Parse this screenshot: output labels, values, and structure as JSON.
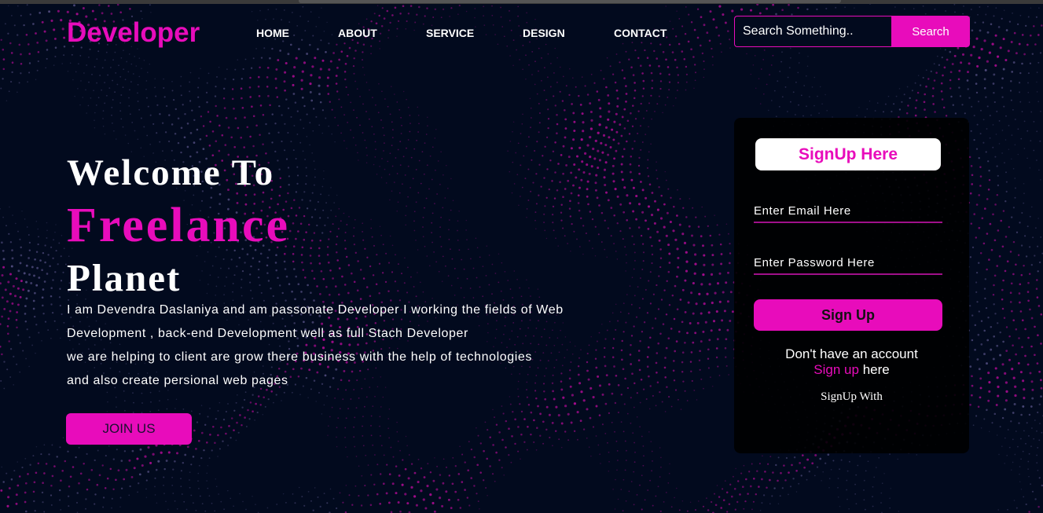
{
  "colors": {
    "accent": "#e80cbb",
    "background": "#020a1e",
    "card": "#000000",
    "text": "#ffffff"
  },
  "header": {
    "logo": "Developer",
    "nav": [
      "HOME",
      "ABOUT",
      "SERVICE",
      "DESIGN",
      "CONTACT"
    ],
    "search": {
      "placeholder": "Search Something..",
      "button_label": "Search"
    }
  },
  "hero": {
    "line1": "Welcome To",
    "line2": "Freelance",
    "line3": "Planet",
    "paragraph": [
      "I am Devendra Daslaniya and am passonate Developer I working the fields of Web",
      "Development , back-end Development well as full Stach Developer",
      "we are helping to client are grow there business with the help of technologies",
      "and also create persional web pages"
    ],
    "join_label": "JOIN US"
  },
  "signup_card": {
    "heading": "SignUp Here",
    "email_placeholder": "Enter Email Here",
    "password_placeholder": "Enter Password Here",
    "button_label": "Sign Up",
    "no_account_text": "Don't have an account",
    "signup_link": "Sign up",
    "here_text": "here",
    "signup_with": "SignUp With"
  },
  "background": {
    "icon": "dotted-particle-wave"
  }
}
